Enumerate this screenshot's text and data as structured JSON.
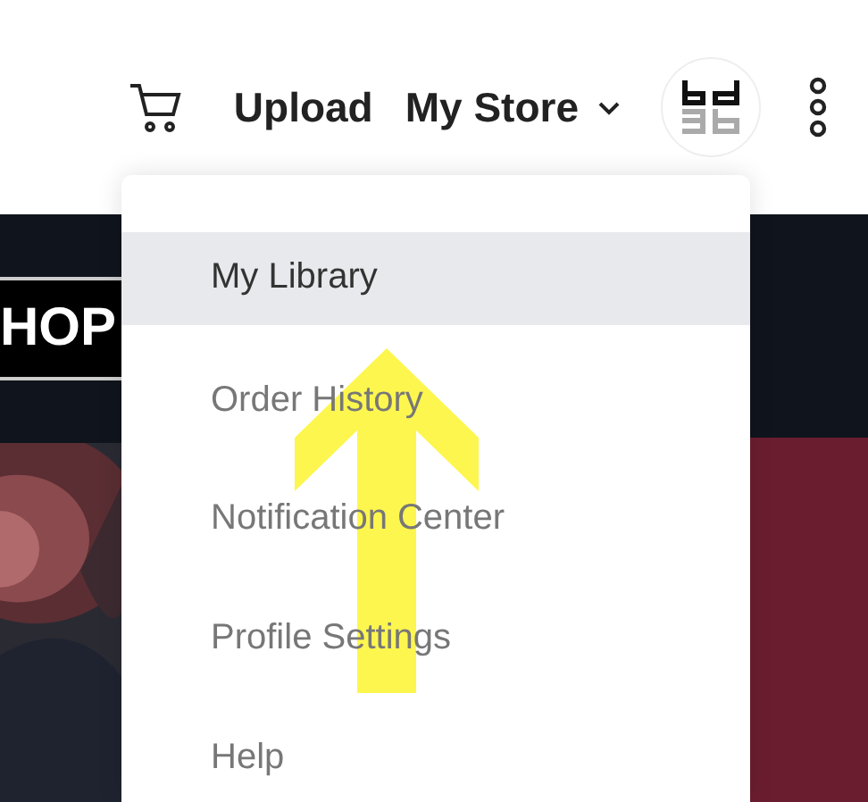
{
  "header": {
    "nav": [
      {
        "label": "Upload",
        "dropdown": false
      },
      {
        "label": "My Store",
        "dropdown": true
      }
    ]
  },
  "banner": {
    "text": "HOP"
  },
  "menu": {
    "items": [
      {
        "label": "My Library",
        "selected": true
      },
      {
        "label": "Order History",
        "selected": false
      },
      {
        "label": "Notification Center",
        "selected": false
      },
      {
        "label": "Profile Settings",
        "selected": false
      },
      {
        "label": "Help",
        "selected": false
      }
    ]
  }
}
